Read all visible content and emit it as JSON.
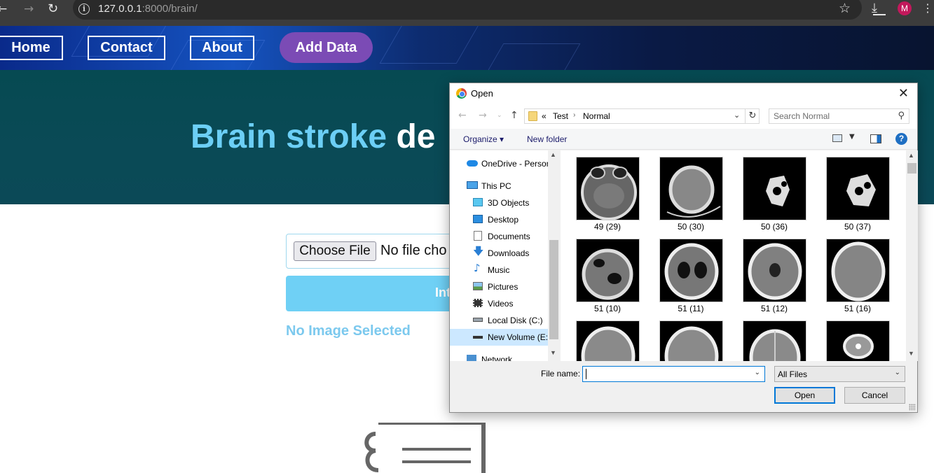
{
  "browser": {
    "url_host": "127.0.0.1",
    "url_rest": ":8000/brain/",
    "avatar_letter": "M"
  },
  "nav": {
    "home": "Home",
    "contact": "Contact",
    "about": "About",
    "add_data": "Add Data"
  },
  "hero": {
    "title_part1": "Brain stroke ",
    "title_part2": "de"
  },
  "form": {
    "choose_file": "Choose File",
    "no_file": "No file cho",
    "submit_partial": "Int",
    "no_image": "No Image Selected"
  },
  "dialog": {
    "title": "Open",
    "path_prefix": "«",
    "path": [
      "Test",
      "Normal"
    ],
    "search_placeholder": "Search Normal",
    "organize": "Organize ▾",
    "new_folder": "New folder",
    "tree": [
      {
        "label": "OneDrive - Person",
        "icon": "cloud-icon"
      },
      {
        "label": "This PC",
        "icon": "computer-icon"
      },
      {
        "label": "3D Objects",
        "icon": "cube-icon"
      },
      {
        "label": "Desktop",
        "icon": "desktop-icon"
      },
      {
        "label": "Documents",
        "icon": "document-icon"
      },
      {
        "label": "Downloads",
        "icon": "download-icon"
      },
      {
        "label": "Music",
        "icon": "music-icon"
      },
      {
        "label": "Pictures",
        "icon": "picture-icon"
      },
      {
        "label": "Videos",
        "icon": "video-icon"
      },
      {
        "label": "Local Disk (C:)",
        "icon": "drive-icon"
      },
      {
        "label": "New Volume (E:)",
        "icon": "drive-icon"
      },
      {
        "label": "Network",
        "icon": "network-icon"
      }
    ],
    "files": [
      "49 (29)",
      "50 (30)",
      "50 (36)",
      "50 (37)",
      "51 (10)",
      "51 (11)",
      "51 (12)",
      "51 (16)",
      "",
      "",
      "",
      ""
    ],
    "file_name_label": "File name:",
    "file_name_value": "",
    "file_type": "All Files",
    "open_btn": "Open",
    "cancel_btn": "Cancel"
  },
  "colors": {
    "accent": "#0078d7",
    "hero_bg": "#0a4a56",
    "title_blue": "#6ccff6",
    "add_data": "#7b4bb5"
  }
}
